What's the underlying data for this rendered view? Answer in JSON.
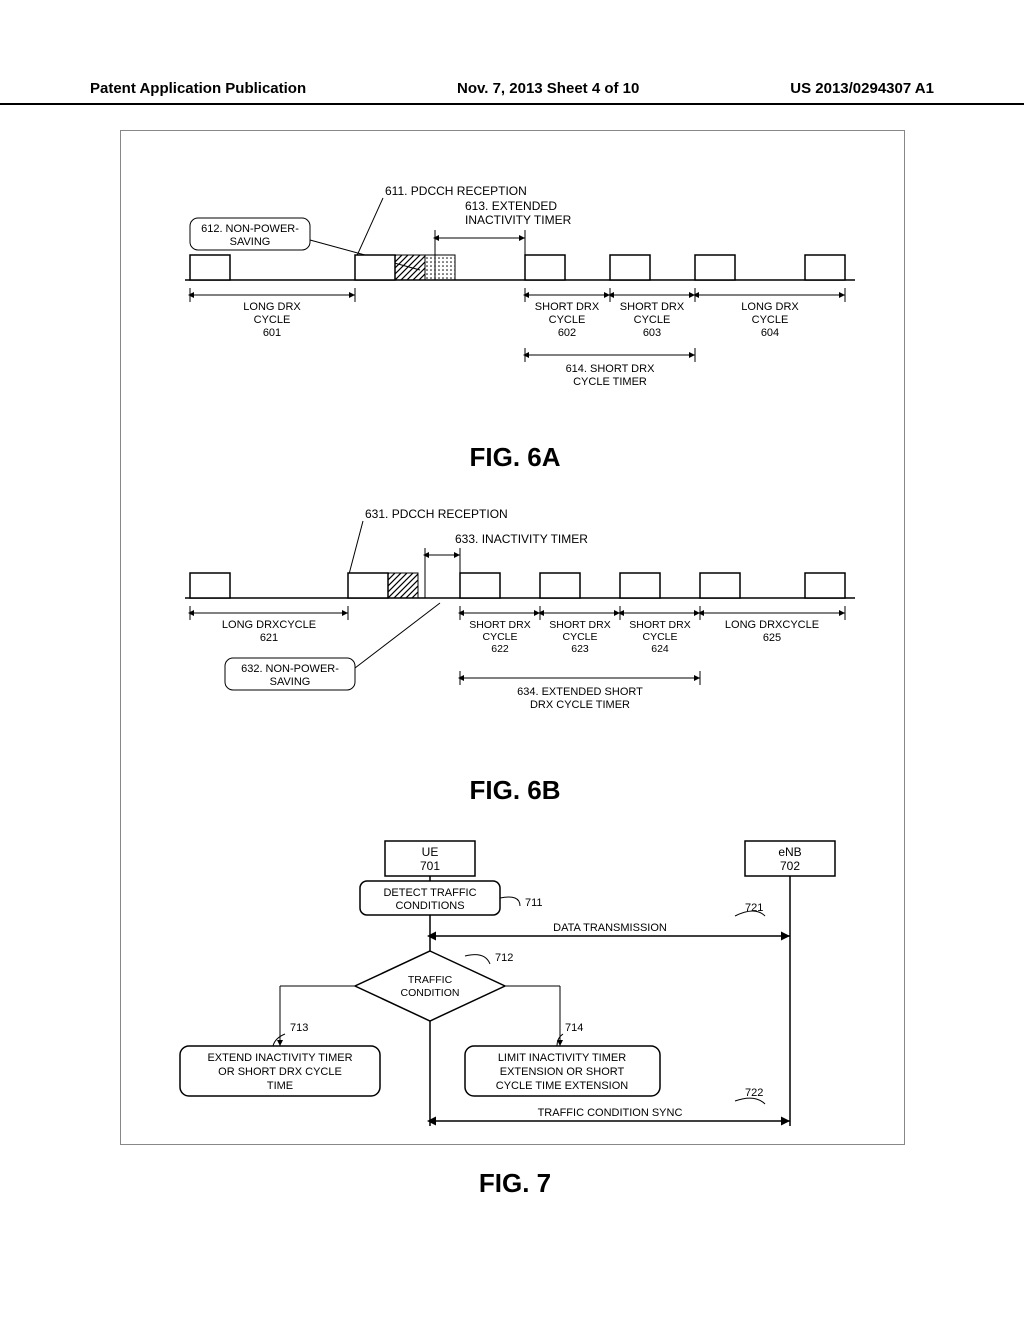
{
  "header": {
    "left": "Patent Application Publication",
    "center": "Nov. 7, 2013  Sheet 4 of 10",
    "right": "US 2013/0294307 A1"
  },
  "fig6a": {
    "title": "FIG. 6A",
    "label_611": "611. PDCCH RECEPTION",
    "label_612": "612. NON-POWER-\nSAVING",
    "label_613": "613. EXTENDED\nINACTIVITY TIMER",
    "cycle_601": "LONG DRX\nCYCLE\n601",
    "cycle_602": "SHORT DRX\nCYCLE\n602",
    "cycle_603": "SHORT DRX\nCYCLE\n603",
    "cycle_604": "LONG DRX\nCYCLE\n604",
    "label_614": "614. SHORT DRX\nCYCLE TIMER"
  },
  "fig6b": {
    "title": "FIG. 6B",
    "label_631": "631. PDCCH RECEPTION",
    "label_632": "632. NON-POWER-\nSAVING",
    "label_633": "633. INACTIVITY TIMER",
    "cycle_621": "LONG DRXCYCLE\n621",
    "cycle_622": "SHORT DRX\nCYCLE\n622",
    "cycle_623": "SHORT DRX\nCYCLE\n623",
    "cycle_624": "SHORT DRX\nCYCLE\n624",
    "cycle_625": "LONG DRXCYCLE\n625",
    "label_634": "634. EXTENDED SHORT\nDRX CYCLE TIMER"
  },
  "fig7": {
    "title": "FIG. 7",
    "ue": "UE\n701",
    "enb": "eNB\n702",
    "step_711": "DETECT TRAFFIC\nCONDITIONS",
    "ref_711": "711",
    "arrow_721": "DATA TRANSMISSION",
    "ref_721": "721",
    "decision_712": "TRAFFIC\nCONDITION",
    "ref_712": "712",
    "step_713": "EXTEND INACTIVITY TIMER\nOR SHORT DRX CYCLE\nTIME",
    "ref_713": "713",
    "step_714": "LIMIT INACTIVITY TIMER\nEXTENSION OR SHORT\nCYCLE TIME EXTENSION",
    "ref_714": "714",
    "arrow_722": "TRAFFIC CONDITION SYNC",
    "ref_722": "722"
  }
}
